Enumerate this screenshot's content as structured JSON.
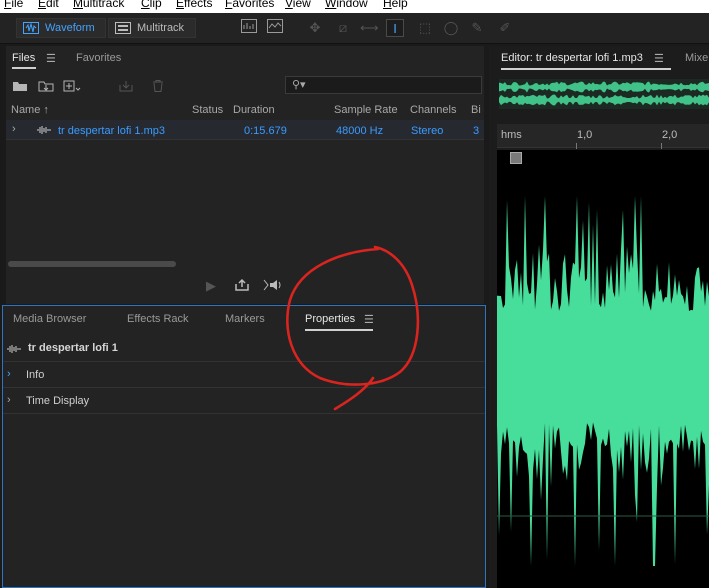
{
  "menu": [
    "File",
    "Edit",
    "Multitrack",
    "Clip",
    "Effects",
    "Favorites",
    "View",
    "Window",
    "Help"
  ],
  "toolbar": {
    "waveform_label": "Waveform",
    "multitrack_label": "Multitrack"
  },
  "files_panel": {
    "tabs": [
      "Files",
      "Favorites"
    ],
    "columns": [
      "Name",
      "Status",
      "Duration",
      "Sample Rate",
      "Channels",
      "Bi"
    ],
    "rows": [
      {
        "name": "tr despertar lofi 1.mp3",
        "status": "",
        "duration": "0:15.679",
        "sample_rate": "48000 Hz",
        "channels": "Stereo",
        "bits": "3"
      }
    ]
  },
  "props_panel": {
    "tabs": [
      "Media Browser",
      "Effects Rack",
      "Markers",
      "Properties"
    ],
    "active_tab": "Properties",
    "file_title": "tr despertar lofi 1",
    "sections": [
      "Info",
      "Time Display"
    ]
  },
  "editor": {
    "tab_label": "Editor: tr despertar lofi 1.mp3",
    "next_tab_label": "Mixe",
    "ruler_labels": [
      "hms",
      "1,0",
      "2,0"
    ]
  },
  "colors": {
    "accent": "#45a3ff",
    "file_link": "#3a9bff",
    "waveform": "#47dd9a",
    "annotation": "#d9241f"
  }
}
